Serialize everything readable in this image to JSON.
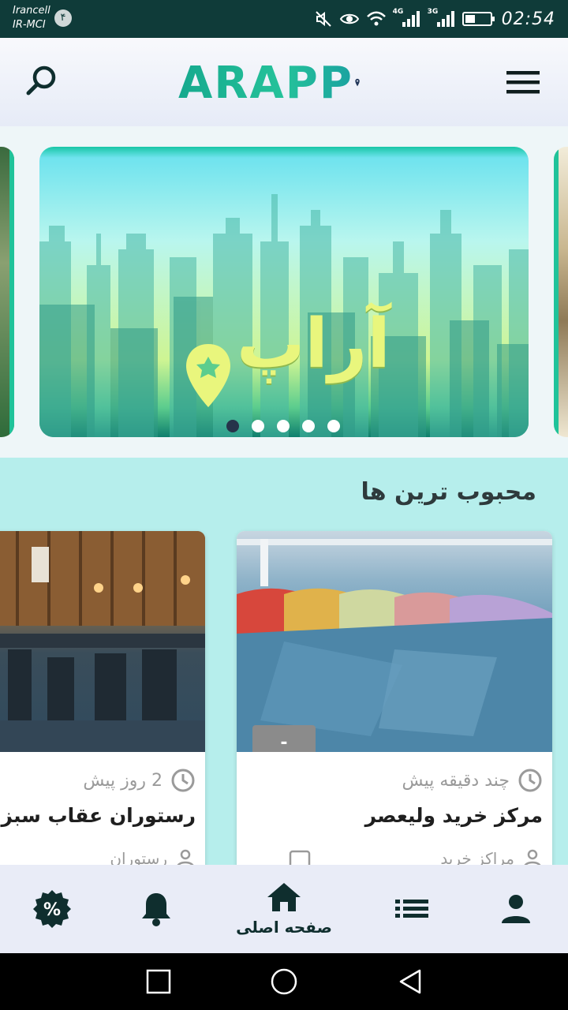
{
  "status_bar": {
    "carrier_line1": "Irancell",
    "carrier_line2": "IR-MCI",
    "notification_count": "۴",
    "network_1": "4G",
    "network_2": "3G",
    "time": "02:54"
  },
  "app_bar": {
    "logo_text": "ARAPP",
    "search_icon": "search-icon",
    "menu_icon": "hamburger-menu-icon"
  },
  "banner": {
    "text": "آراپ",
    "slide_count": 5,
    "active_index": 0
  },
  "popular": {
    "title": "محبوب ترین ها",
    "items": [
      {
        "name": "مرکز خرید ولیعصر",
        "time": "چند دقیقه پیش",
        "discount_label": "-",
        "category": "مراکز خرید"
      },
      {
        "name": "رستوران عقاب سبز",
        "time": "2 روز پیش",
        "category": "رستوران"
      }
    ]
  },
  "bottom_nav": {
    "items": [
      {
        "icon": "discount-badge-icon",
        "label": ""
      },
      {
        "icon": "bell-icon",
        "label": ""
      },
      {
        "icon": "home-icon",
        "label": "صفحه اصلی"
      },
      {
        "icon": "list-icon",
        "label": ""
      },
      {
        "icon": "person-icon",
        "label": ""
      }
    ],
    "active": "home"
  },
  "colors": {
    "status_bar": "#0f3b39",
    "accent": "#1fc39a",
    "section_bg": "#b6eeec",
    "dark_text": "#0f2e2e"
  }
}
